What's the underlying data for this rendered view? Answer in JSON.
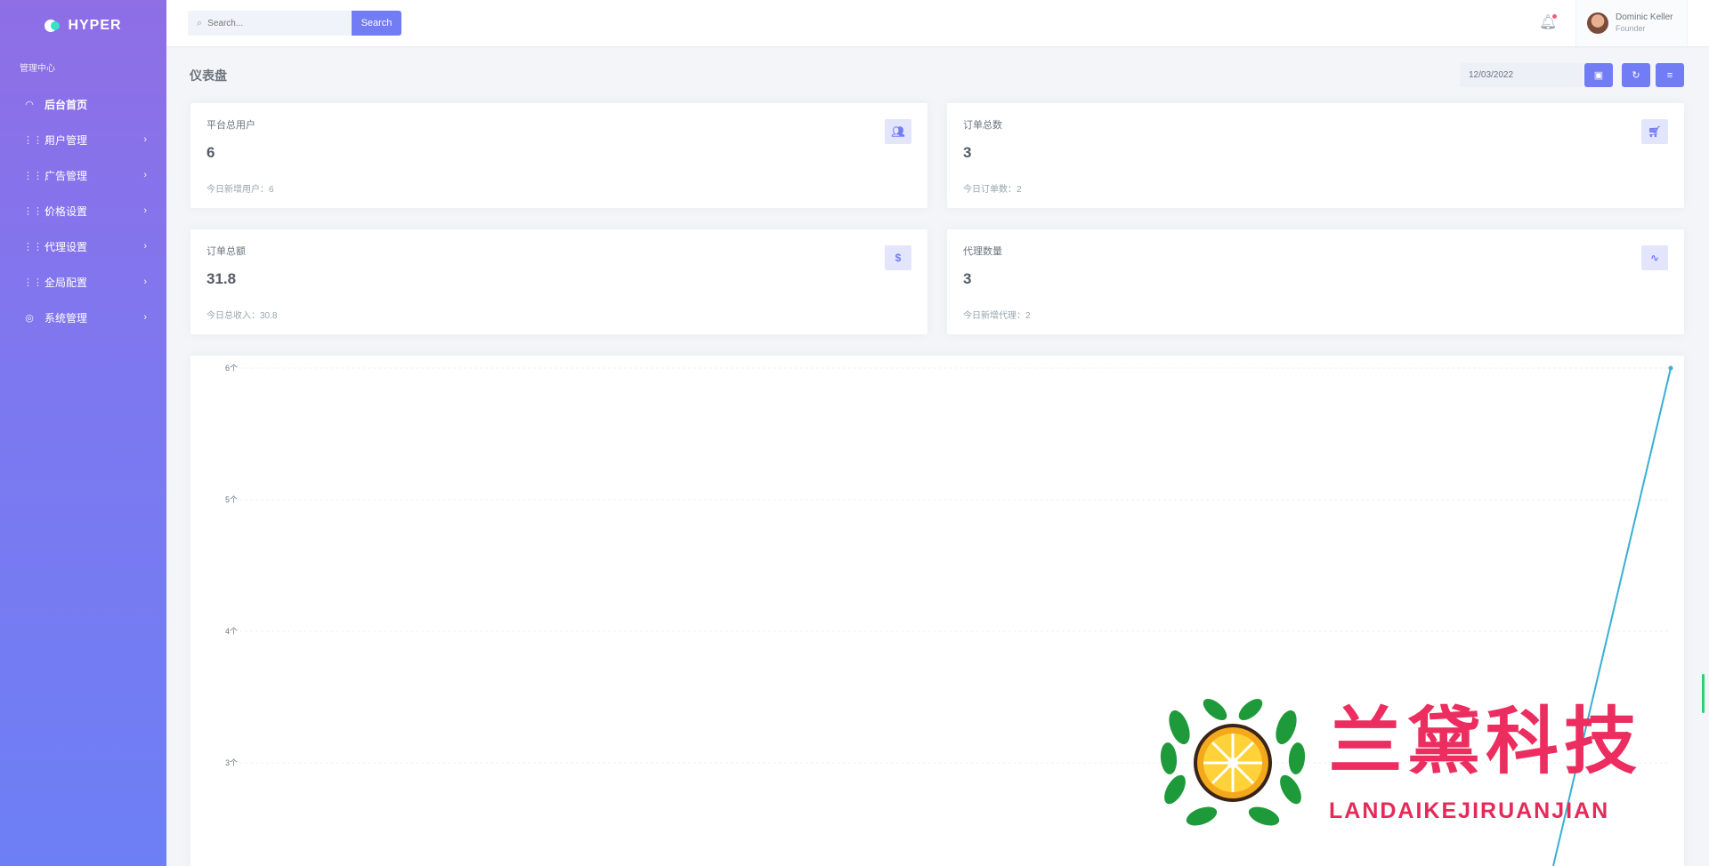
{
  "app": {
    "name": "HYPER"
  },
  "sidebar": {
    "section_title": "管理中心",
    "items": [
      {
        "label": "后台首页",
        "icon": "speedometer-icon"
      },
      {
        "label": "用户管理",
        "icon": "grid-icon"
      },
      {
        "label": "广告管理",
        "icon": "grid-icon"
      },
      {
        "label": "价格设置",
        "icon": "grid-icon"
      },
      {
        "label": "代理设置",
        "icon": "grid-icon"
      },
      {
        "label": "全局配置",
        "icon": "grid-icon"
      },
      {
        "label": "系统管理",
        "icon": "location-pin-icon"
      }
    ]
  },
  "topbar": {
    "search_placeholder": "Search...",
    "search_button": "Search",
    "user_name": "Dominic Keller",
    "user_role": "Founder"
  },
  "page": {
    "title": "仪表盘",
    "date": "12/03/2022"
  },
  "stats": [
    {
      "title": "平台总用户",
      "value": "6",
      "sub": "今日新增用户：6",
      "icon": "users-icon"
    },
    {
      "title": "订单总数",
      "value": "3",
      "sub": "今日订单数：2",
      "icon": "cart-icon"
    },
    {
      "title": "订单总额",
      "value": "31.8",
      "sub": "今日总收入：30.8",
      "icon": "dollar-icon"
    },
    {
      "title": "代理数量",
      "value": "3",
      "sub": "今日新增代理：2",
      "icon": "pulse-icon"
    }
  ],
  "chart_data": {
    "type": "line",
    "yticks": [
      "6个",
      "5个",
      "4个",
      "3个"
    ],
    "ylim_visible": [
      2.2,
      6
    ],
    "series": [
      {
        "values": [
          6
        ],
        "x_position": "last"
      }
    ],
    "grid": true,
    "color": "#39afd1"
  },
  "watermark": {
    "text": "兰黛科技",
    "subtext": "LANDAIKEJIRUANJIAN"
  }
}
